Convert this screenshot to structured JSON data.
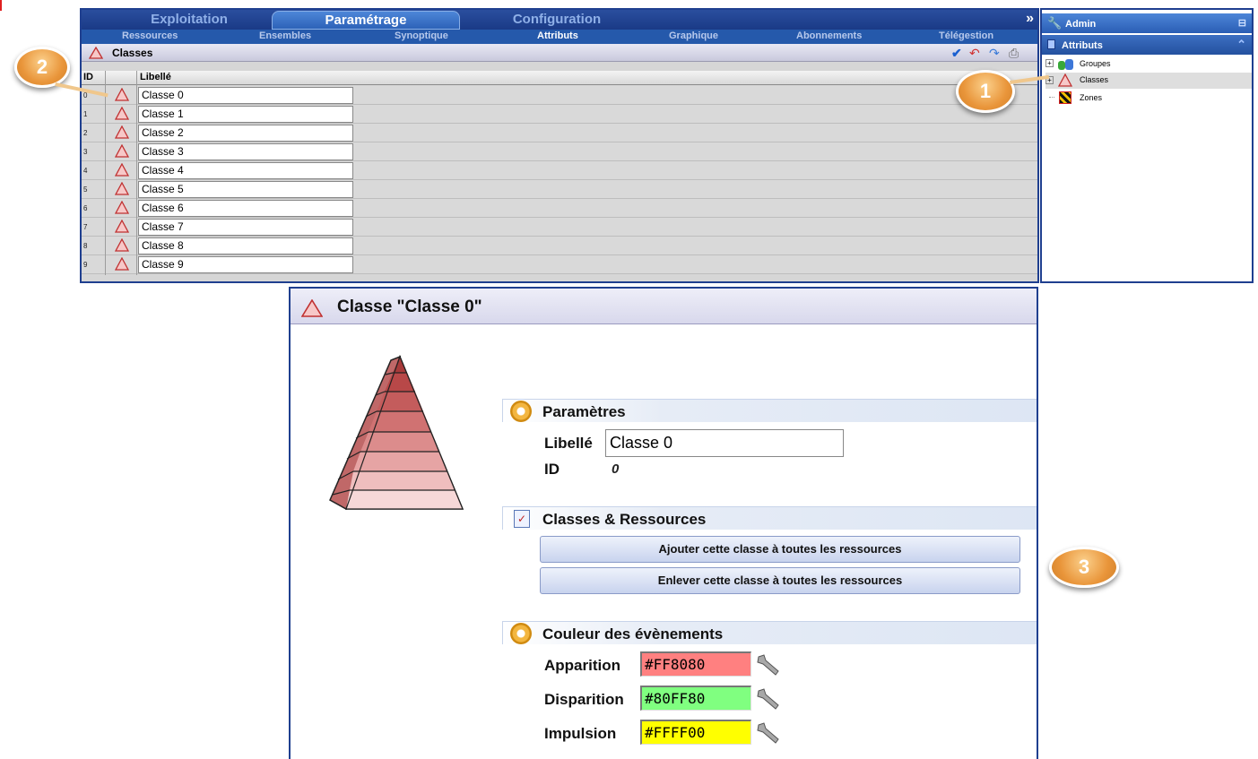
{
  "top_tabs": [
    "Exploitation",
    "Paramétrage",
    "Configuration"
  ],
  "active_tab": "Paramétrage",
  "sub_nav": [
    "Ressources",
    "Ensembles",
    "Synoptique",
    "Attributs",
    "Graphique",
    "Abonnements",
    "Télégestion"
  ],
  "active_sub": "Attributs",
  "list": {
    "title": "Classes",
    "col_id": "ID",
    "col_label": "Libellé",
    "rows": [
      {
        "id": "0",
        "label": "Classe 0"
      },
      {
        "id": "1",
        "label": "Classe 1"
      },
      {
        "id": "2",
        "label": "Classe 2"
      },
      {
        "id": "3",
        "label": "Classe 3"
      },
      {
        "id": "4",
        "label": "Classe 4"
      },
      {
        "id": "5",
        "label": "Classe 5"
      },
      {
        "id": "6",
        "label": "Classe 6"
      },
      {
        "id": "7",
        "label": "Classe 7"
      },
      {
        "id": "8",
        "label": "Classe 8"
      },
      {
        "id": "9",
        "label": "Classe 9"
      }
    ]
  },
  "tree": {
    "user": "Admin",
    "section": "Attributs",
    "items": [
      "Groupes",
      "Classes",
      "Zones"
    ],
    "selected": "Classes"
  },
  "callouts": [
    "1",
    "2",
    "3"
  ],
  "detail": {
    "title": "Classe \"Classe 0\"",
    "params_section": "Paramètres",
    "libelle_label": "Libellé",
    "libelle_value": "Classe 0",
    "id_label": "ID",
    "id_value": "0",
    "resources_section": "Classes & Ressources",
    "add_button": "Ajouter cette classe à toutes les ressources",
    "remove_button": "Enlever cette classe à toutes les ressources",
    "colors_section": "Couleur des évènements",
    "colors": [
      {
        "label": "Apparition",
        "value": "#FF8080"
      },
      {
        "label": "Disparition",
        "value": "#80FF80"
      },
      {
        "label": "Impulsion",
        "value": "#FFFF00"
      }
    ]
  },
  "theme": {
    "accent": "#2559ab",
    "frame": "#1f3f8f",
    "badge": "#e9953a"
  }
}
